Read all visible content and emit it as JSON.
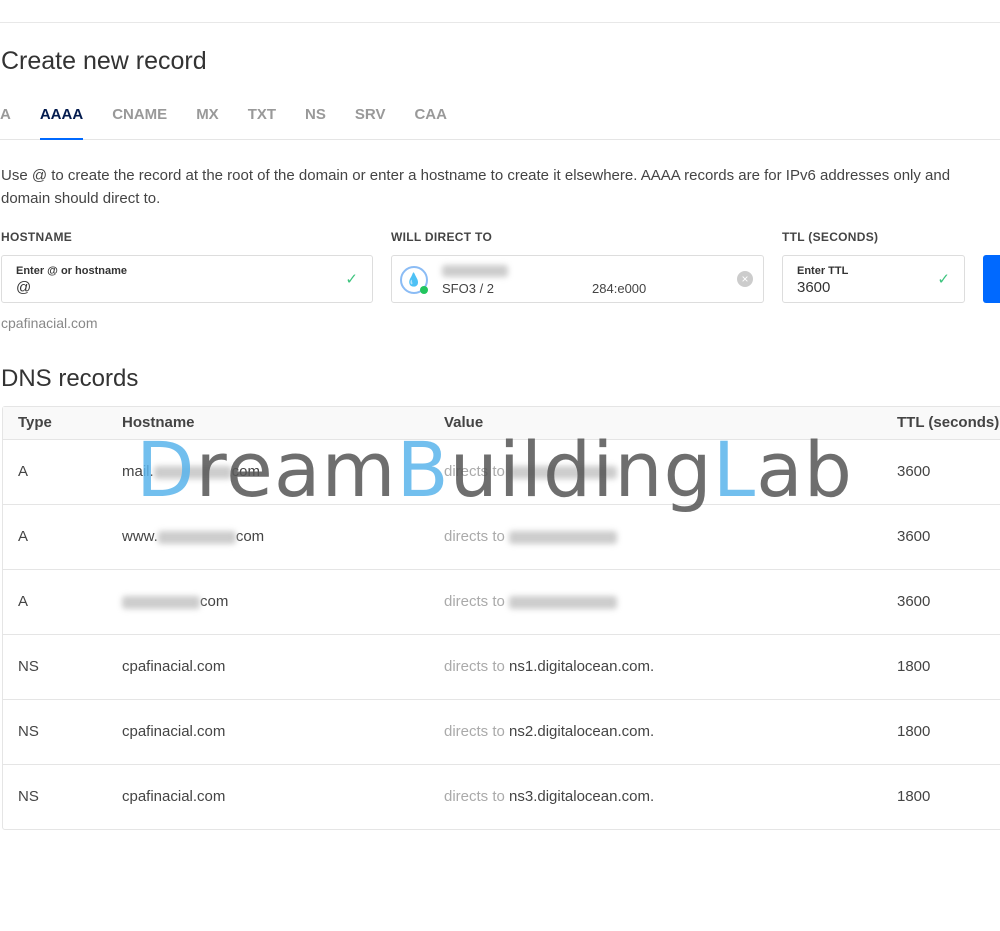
{
  "title": "Create new record",
  "tabs": [
    "A",
    "AAAA",
    "CNAME",
    "MX",
    "TXT",
    "NS",
    "SRV",
    "CAA"
  ],
  "active_tab": "AAAA",
  "description_line1": "Use @ to create the record at the root of the domain or enter a hostname to create it elsewhere. AAAA records are for IPv6 addresses only and",
  "description_line2": "domain should direct to.",
  "form": {
    "hostname_label": "HOSTNAME",
    "hostname_placeholder": "Enter @ or hostname",
    "hostname_value": "@",
    "direct_label": "WILL DIRECT TO",
    "direct_prefix": "SFO3 / 2",
    "direct_suffix": "284:e000",
    "ttl_label": "TTL (SECONDS)",
    "ttl_placeholder": "Enter TTL",
    "ttl_value": "3600",
    "helper": "cpafinacial.com"
  },
  "dns_title": "DNS records",
  "columns": [
    "Type",
    "Hostname",
    "Value",
    "TTL (seconds)"
  ],
  "directs_to": "directs to",
  "rows": [
    {
      "type": "A",
      "host_prefix": "mail.",
      "host_suffix": "com",
      "value": "",
      "ttl": "3600"
    },
    {
      "type": "A",
      "host_prefix": "www.",
      "host_suffix": "com",
      "value": "",
      "ttl": "3600"
    },
    {
      "type": "A",
      "host_prefix": "",
      "host_suffix": "com",
      "value": "",
      "ttl": "3600"
    },
    {
      "type": "NS",
      "host_prefix": "cpafinacial.com",
      "host_suffix": "",
      "value": "ns1.digitalocean.com.",
      "ttl": "1800"
    },
    {
      "type": "NS",
      "host_prefix": "cpafinacial.com",
      "host_suffix": "",
      "value": "ns2.digitalocean.com.",
      "ttl": "1800"
    },
    {
      "type": "NS",
      "host_prefix": "cpafinacial.com",
      "host_suffix": "",
      "value": "ns3.digitalocean.com.",
      "ttl": "1800"
    }
  ],
  "watermark": "DreamBuildingLab",
  "colors": {
    "accent": "#0069ff",
    "success": "#3dc47e"
  }
}
